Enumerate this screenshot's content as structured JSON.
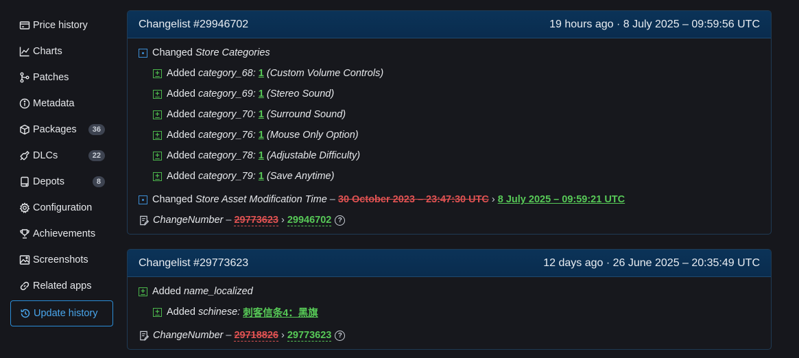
{
  "sidebar": {
    "items": [
      {
        "label": "Price history",
        "icon": "price-history-icon"
      },
      {
        "label": "Charts",
        "icon": "chart-icon"
      },
      {
        "label": "Patches",
        "icon": "patches-icon"
      },
      {
        "label": "Metadata",
        "icon": "info-icon"
      },
      {
        "label": "Packages",
        "icon": "package-icon",
        "badge": "36"
      },
      {
        "label": "DLCs",
        "icon": "dlc-icon",
        "badge": "22"
      },
      {
        "label": "Depots",
        "icon": "depot-icon",
        "badge": "8"
      },
      {
        "label": "Configuration",
        "icon": "gear-icon"
      },
      {
        "label": "Achievements",
        "icon": "trophy-icon"
      },
      {
        "label": "Screenshots",
        "icon": "image-icon"
      },
      {
        "label": "Related apps",
        "icon": "link-icon"
      },
      {
        "label": "Update history",
        "icon": "history-icon",
        "active": true
      }
    ]
  },
  "changelists": [
    {
      "title": "Changelist #29946702",
      "time": "19 hours ago · 8 July 2025 – 09:59:56 UTC",
      "section": {
        "verb": "Changed",
        "name": "Store Categories"
      },
      "items": [
        {
          "verb": "Added",
          "key": "category_68:",
          "value": "1",
          "note": "(Custom Volume Controls)"
        },
        {
          "verb": "Added",
          "key": "category_69:",
          "value": "1",
          "note": "(Stereo Sound)"
        },
        {
          "verb": "Added",
          "key": "category_70:",
          "value": "1",
          "note": "(Surround Sound)"
        },
        {
          "verb": "Added",
          "key": "category_76:",
          "value": "1",
          "note": "(Mouse Only Option)"
        },
        {
          "verb": "Added",
          "key": "category_78:",
          "value": "1",
          "note": "(Adjustable Difficulty)"
        },
        {
          "verb": "Added",
          "key": "category_79:",
          "value": "1",
          "note": "(Save Anytime)"
        }
      ],
      "modified": {
        "verb": "Changed",
        "name": "Store Asset Modification Time",
        "dash": "–",
        "old": "30 October 2023 – 23:47:30 UTC",
        "arrow": "›",
        "new": "8 July 2025 – 09:59:21 UTC"
      },
      "changenumber": {
        "label": "ChangeNumber",
        "dash": "–",
        "old": "29773623",
        "arrow": "›",
        "new": "29946702",
        "help": "?"
      }
    },
    {
      "title": "Changelist #29773623",
      "time": "12 days ago · 26 June 2025 – 20:35:49 UTC",
      "section": {
        "verb": "Added",
        "name": "name_localized"
      },
      "items": [
        {
          "verb": "Added",
          "key": "schinese:",
          "value": "刺客信条4：黑旗"
        }
      ],
      "changenumber": {
        "label": "ChangeNumber",
        "dash": "–",
        "old": "29718826",
        "arrow": "›",
        "new": "29773623",
        "help": "?"
      }
    }
  ],
  "colors": {
    "accent": "#2b8ed8",
    "added": "#57c957",
    "removed": "#e05252",
    "header": "#0b3358"
  }
}
